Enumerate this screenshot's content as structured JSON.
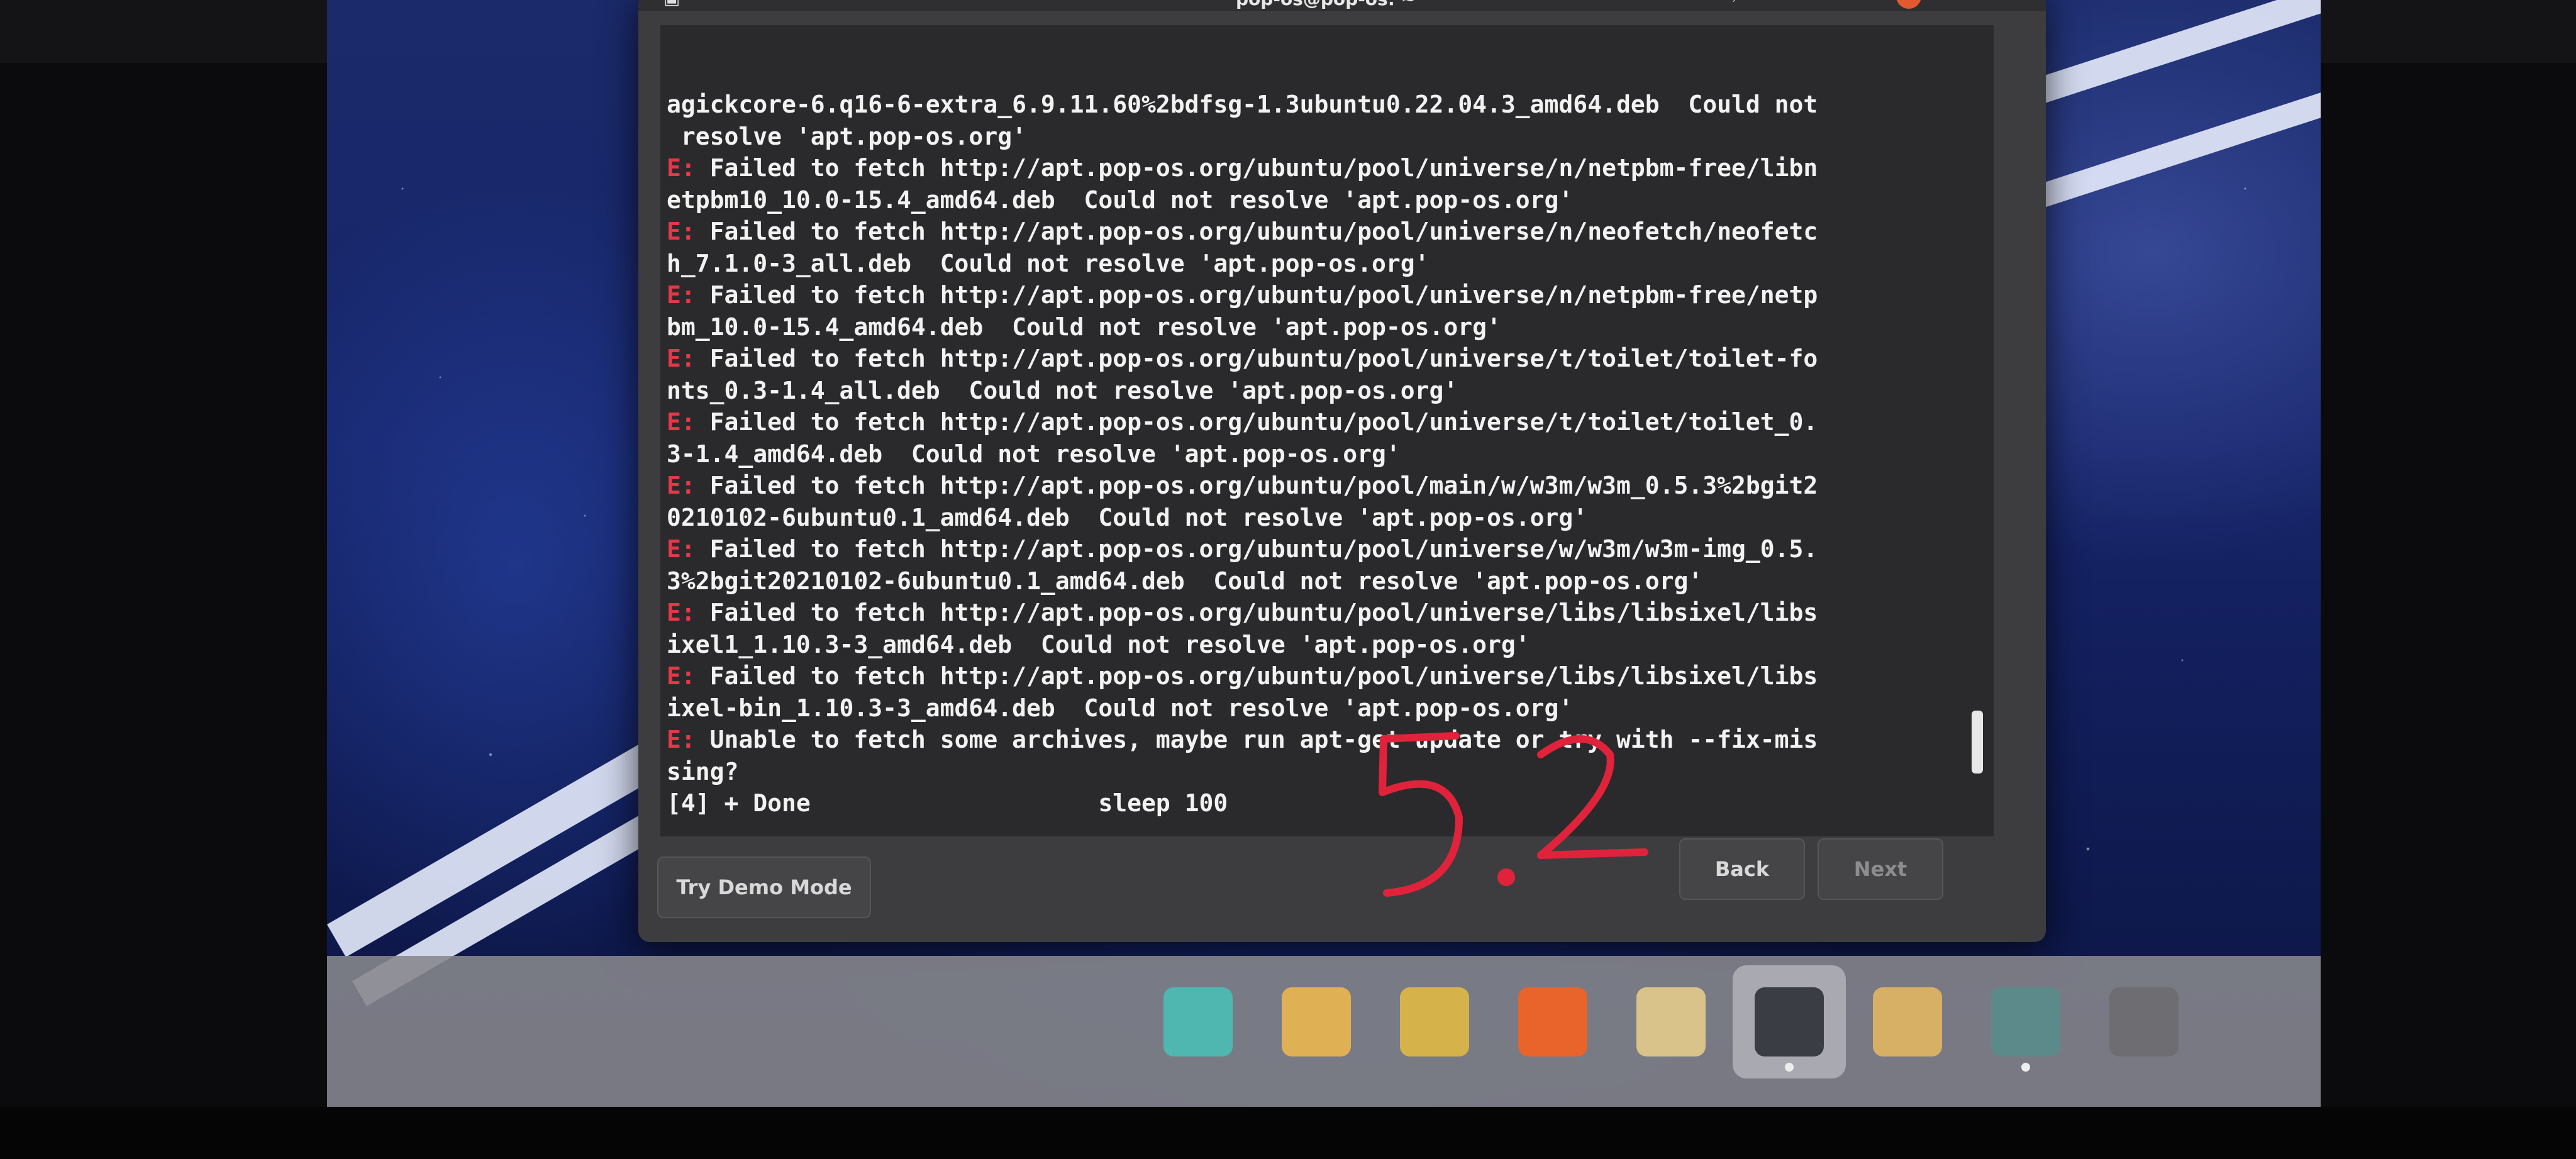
{
  "window": {
    "title": "pop-os@pop-os: ~"
  },
  "terminal": {
    "lines": [
      {
        "prefix": "",
        "text": "agickcore-6.q16-6-extra_6.9.11.60%2bdfsg-1.3ubuntu0.22.04.3_amd64.deb  Could not"
      },
      {
        "prefix": "",
        "text": " resolve 'apt.pop-os.org'"
      },
      {
        "prefix": "E:",
        "text": " Failed to fetch http://apt.pop-os.org/ubuntu/pool/universe/n/netpbm-free/libn"
      },
      {
        "prefix": "",
        "text": "etpbm10_10.0-15.4_amd64.deb  Could not resolve 'apt.pop-os.org'"
      },
      {
        "prefix": "E:",
        "text": " Failed to fetch http://apt.pop-os.org/ubuntu/pool/universe/n/neofetch/neofetc"
      },
      {
        "prefix": "",
        "text": "h_7.1.0-3_all.deb  Could not resolve 'apt.pop-os.org'"
      },
      {
        "prefix": "E:",
        "text": " Failed to fetch http://apt.pop-os.org/ubuntu/pool/universe/n/netpbm-free/netp"
      },
      {
        "prefix": "",
        "text": "bm_10.0-15.4_amd64.deb  Could not resolve 'apt.pop-os.org'"
      },
      {
        "prefix": "E:",
        "text": " Failed to fetch http://apt.pop-os.org/ubuntu/pool/universe/t/toilet/toilet-fo"
      },
      {
        "prefix": "",
        "text": "nts_0.3-1.4_all.deb  Could not resolve 'apt.pop-os.org'"
      },
      {
        "prefix": "E:",
        "text": " Failed to fetch http://apt.pop-os.org/ubuntu/pool/universe/t/toilet/toilet_0."
      },
      {
        "prefix": "",
        "text": "3-1.4_amd64.deb  Could not resolve 'apt.pop-os.org'"
      },
      {
        "prefix": "E:",
        "text": " Failed to fetch http://apt.pop-os.org/ubuntu/pool/main/w/w3m/w3m_0.5.3%2bgit2"
      },
      {
        "prefix": "",
        "text": "0210102-6ubuntu0.1_amd64.deb  Could not resolve 'apt.pop-os.org'"
      },
      {
        "prefix": "E:",
        "text": " Failed to fetch http://apt.pop-os.org/ubuntu/pool/universe/w/w3m/w3m-img_0.5."
      },
      {
        "prefix": "",
        "text": "3%2bgit20210102-6ubuntu0.1_amd64.deb  Could not resolve 'apt.pop-os.org'"
      },
      {
        "prefix": "E:",
        "text": " Failed to fetch http://apt.pop-os.org/ubuntu/pool/universe/libs/libsixel/libs"
      },
      {
        "prefix": "",
        "text": "ixel1_1.10.3-3_amd64.deb  Could not resolve 'apt.pop-os.org'"
      },
      {
        "prefix": "E:",
        "text": " Failed to fetch http://apt.pop-os.org/ubuntu/pool/universe/libs/libsixel/libs"
      },
      {
        "prefix": "",
        "text": "ixel-bin_1.10.3-3_amd64.deb  Could not resolve 'apt.pop-os.org'"
      },
      {
        "prefix": "E:",
        "text": " Unable to fetch some archives, maybe run apt-get update or try with --fix-mis"
      },
      {
        "prefix": "",
        "text": "sing?"
      },
      {
        "prefix": "",
        "text": "[4] + Done                    sleep 100"
      }
    ],
    "prompt": "$ "
  },
  "buttons": {
    "demo": "Try Demo Mode",
    "back": "Back",
    "next": "Next"
  },
  "annotation": {
    "text": "5.2",
    "color": "#e0233a"
  },
  "dock": {
    "items": [
      {
        "name": "pop-shop-icon",
        "color": "#4fb6b0"
      },
      {
        "name": "workspaces-icon",
        "color": "#e0b054"
      },
      {
        "name": "app-grid-icon",
        "color": "#d6b24a"
      },
      {
        "name": "firefox-icon",
        "color": "#e8642b"
      },
      {
        "name": "files-icon",
        "color": "#d9c38a"
      },
      {
        "name": "terminal-icon",
        "color": "#3a3d44"
      },
      {
        "name": "installer-icon",
        "color": "#d7b066"
      },
      {
        "name": "software-updater-icon",
        "color": "#5c8a8a"
      },
      {
        "name": "settings-icon",
        "color": "#6d6d72"
      }
    ]
  }
}
